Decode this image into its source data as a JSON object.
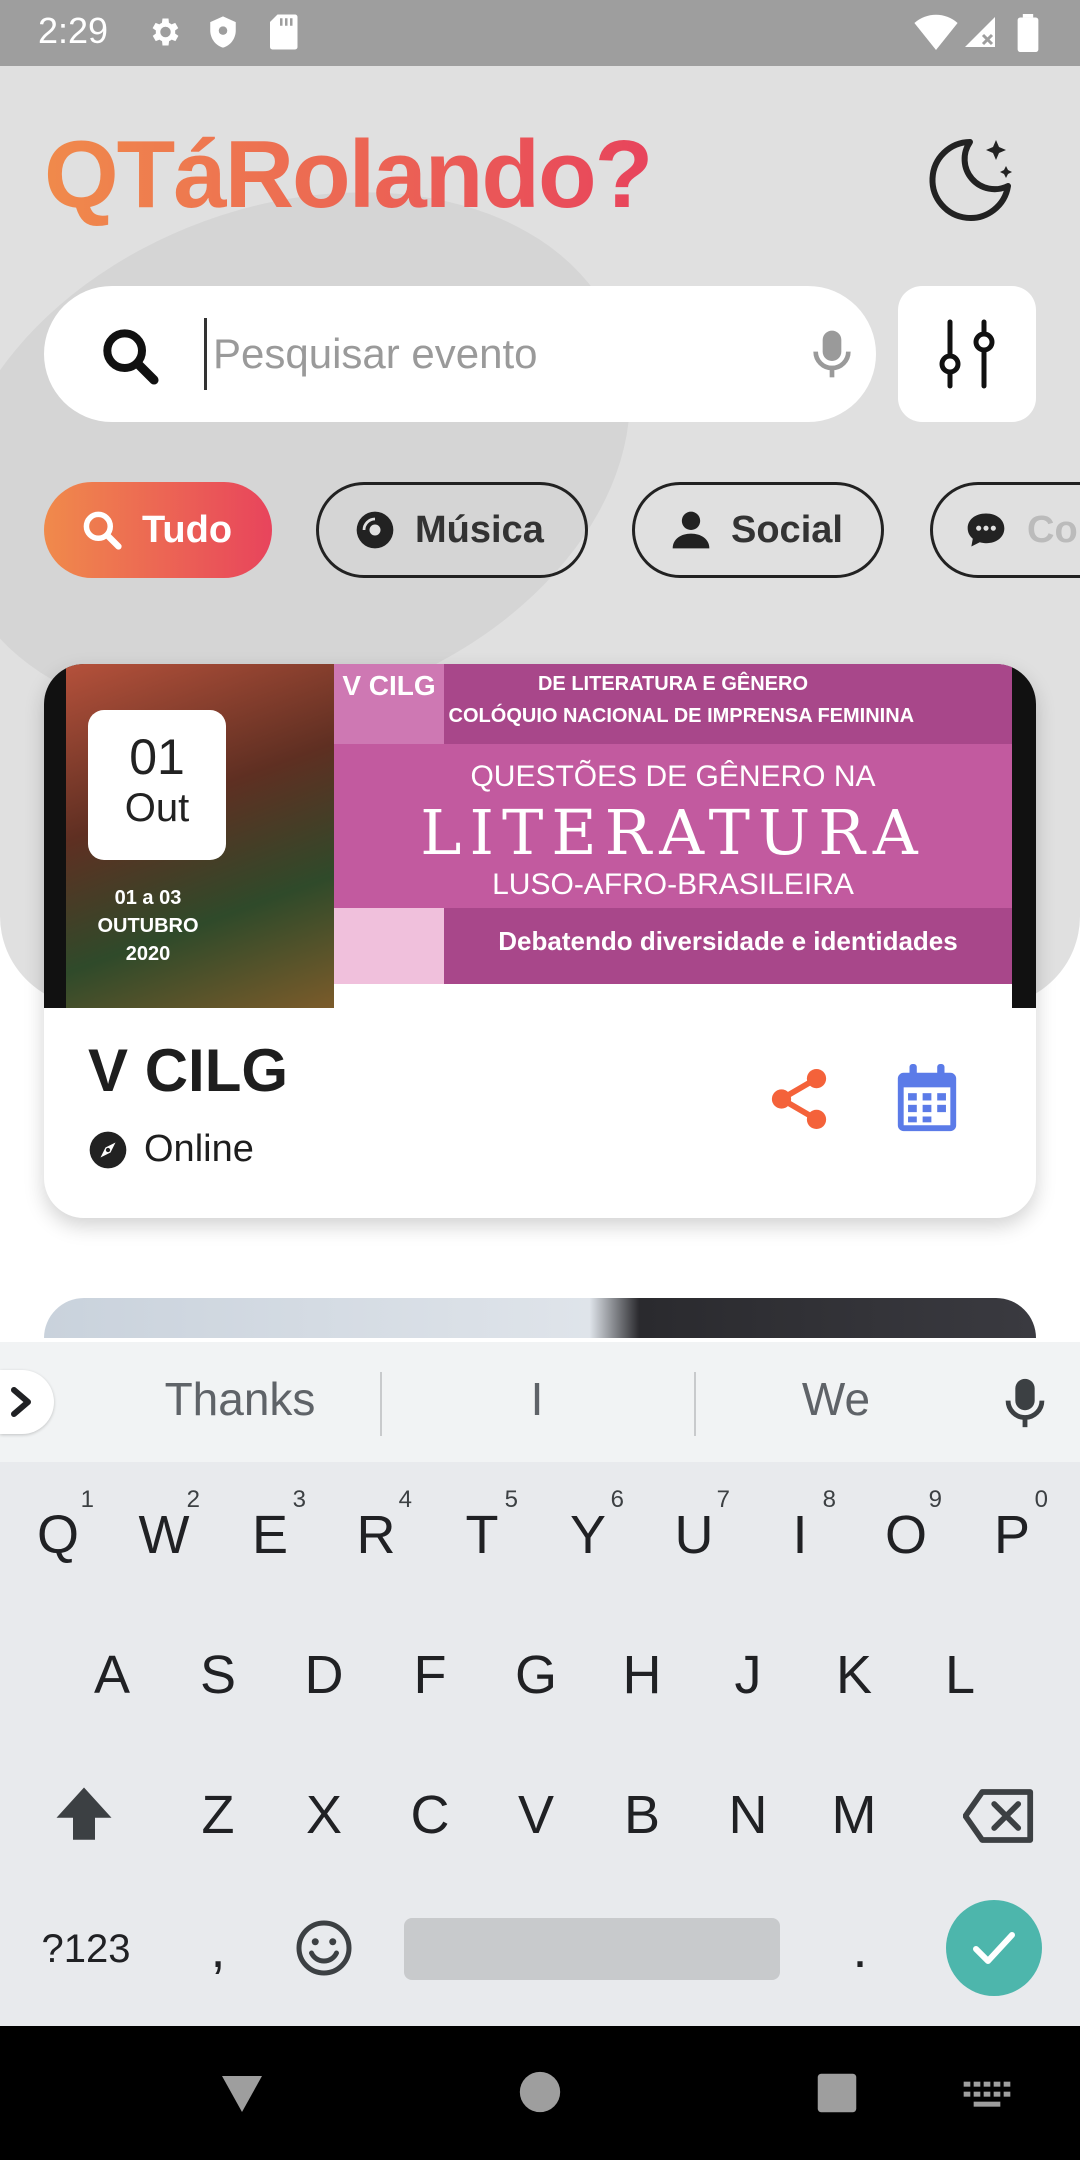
{
  "status_bar": {
    "time": "2:29"
  },
  "header": {
    "app_title": "QTáRolando?"
  },
  "search": {
    "placeholder": "Pesquisar evento"
  },
  "chips": [
    {
      "label": "Tudo",
      "icon": "search-icon",
      "active": true
    },
    {
      "label": "Música",
      "icon": "disc-icon",
      "active": false
    },
    {
      "label": "Social",
      "icon": "person-icon",
      "active": false
    },
    {
      "label": "Co",
      "icon": "chat-icon",
      "active": false
    }
  ],
  "event_card": {
    "date_day": "01",
    "date_month": "Out",
    "title": "V CILG",
    "location": "Online",
    "poster": {
      "badge": "V CILG",
      "top_line1": "DE LITERATURA E GÊNERO",
      "top_line2": "II COLÓQUIO NACIONAL DE IMPRENSA FEMININA",
      "line1": "QUESTÕES DE GÊNERO NA",
      "line2": "LITERATURA",
      "line3": "LUSO-AFRO-BRASILEIRA",
      "line4": "Debatendo diversidade e identidades",
      "date_text": "01 a 03 OUTUBRO 2020"
    }
  },
  "keyboard": {
    "suggestions": [
      "Thanks",
      "I",
      "We"
    ],
    "row1": [
      {
        "key": "Q",
        "num": "1"
      },
      {
        "key": "W",
        "num": "2"
      },
      {
        "key": "E",
        "num": "3"
      },
      {
        "key": "R",
        "num": "4"
      },
      {
        "key": "T",
        "num": "5"
      },
      {
        "key": "Y",
        "num": "6"
      },
      {
        "key": "U",
        "num": "7"
      },
      {
        "key": "I",
        "num": "8"
      },
      {
        "key": "O",
        "num": "9"
      },
      {
        "key": "P",
        "num": "0"
      }
    ],
    "row2": [
      "A",
      "S",
      "D",
      "F",
      "G",
      "H",
      "J",
      "K",
      "L"
    ],
    "row3": [
      "Z",
      "X",
      "C",
      "V",
      "B",
      "N",
      "M"
    ],
    "symbols_key": "?123",
    "comma_key": ",",
    "period_key": "."
  },
  "colors": {
    "accent_start": "#f08a4b",
    "accent_end": "#e8445c",
    "share_orange": "#f4623a",
    "calendar_blue": "#5b7be8",
    "enter_teal": "#4db6ac"
  }
}
